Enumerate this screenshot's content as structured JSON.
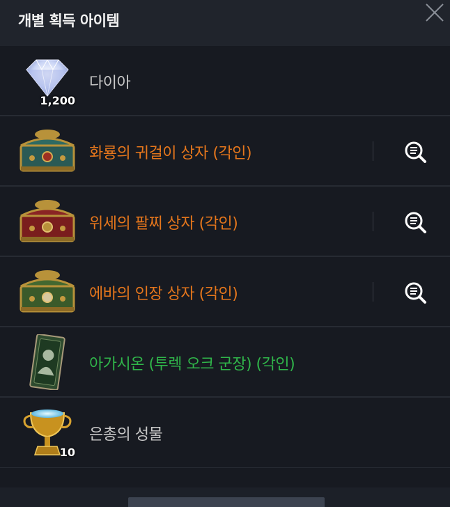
{
  "header": {
    "title": "개별 획득 아이템"
  },
  "items": [
    {
      "name": "다이아",
      "count": "1,200",
      "grade_color": "#c8c8c8",
      "icon": "diamond-icon"
    },
    {
      "name": "화룡의 귀걸이 상자 (각인)",
      "count": "",
      "grade_color": "#e5761c",
      "icon": "chest-icon"
    },
    {
      "name": "위세의 팔찌 상자 (각인)",
      "count": "",
      "grade_color": "#e5761c",
      "icon": "chest-icon"
    },
    {
      "name": "에바의 인장 상자 (각인)",
      "count": "",
      "grade_color": "#e5761c",
      "icon": "chest-icon"
    },
    {
      "name": "아가시온 (투렉 오크 군장) (각인)",
      "count": "",
      "grade_color": "#30b54a",
      "icon": "card-icon"
    },
    {
      "name": "은총의 성물",
      "count": "10",
      "grade_color": "#c8c8c8",
      "icon": "trophy-icon"
    }
  ],
  "colors": {
    "background": "#171a21",
    "header": "#20242c",
    "row_divider": "#272b33",
    "orange_grade": "#e5761c",
    "green_grade": "#30b54a"
  }
}
